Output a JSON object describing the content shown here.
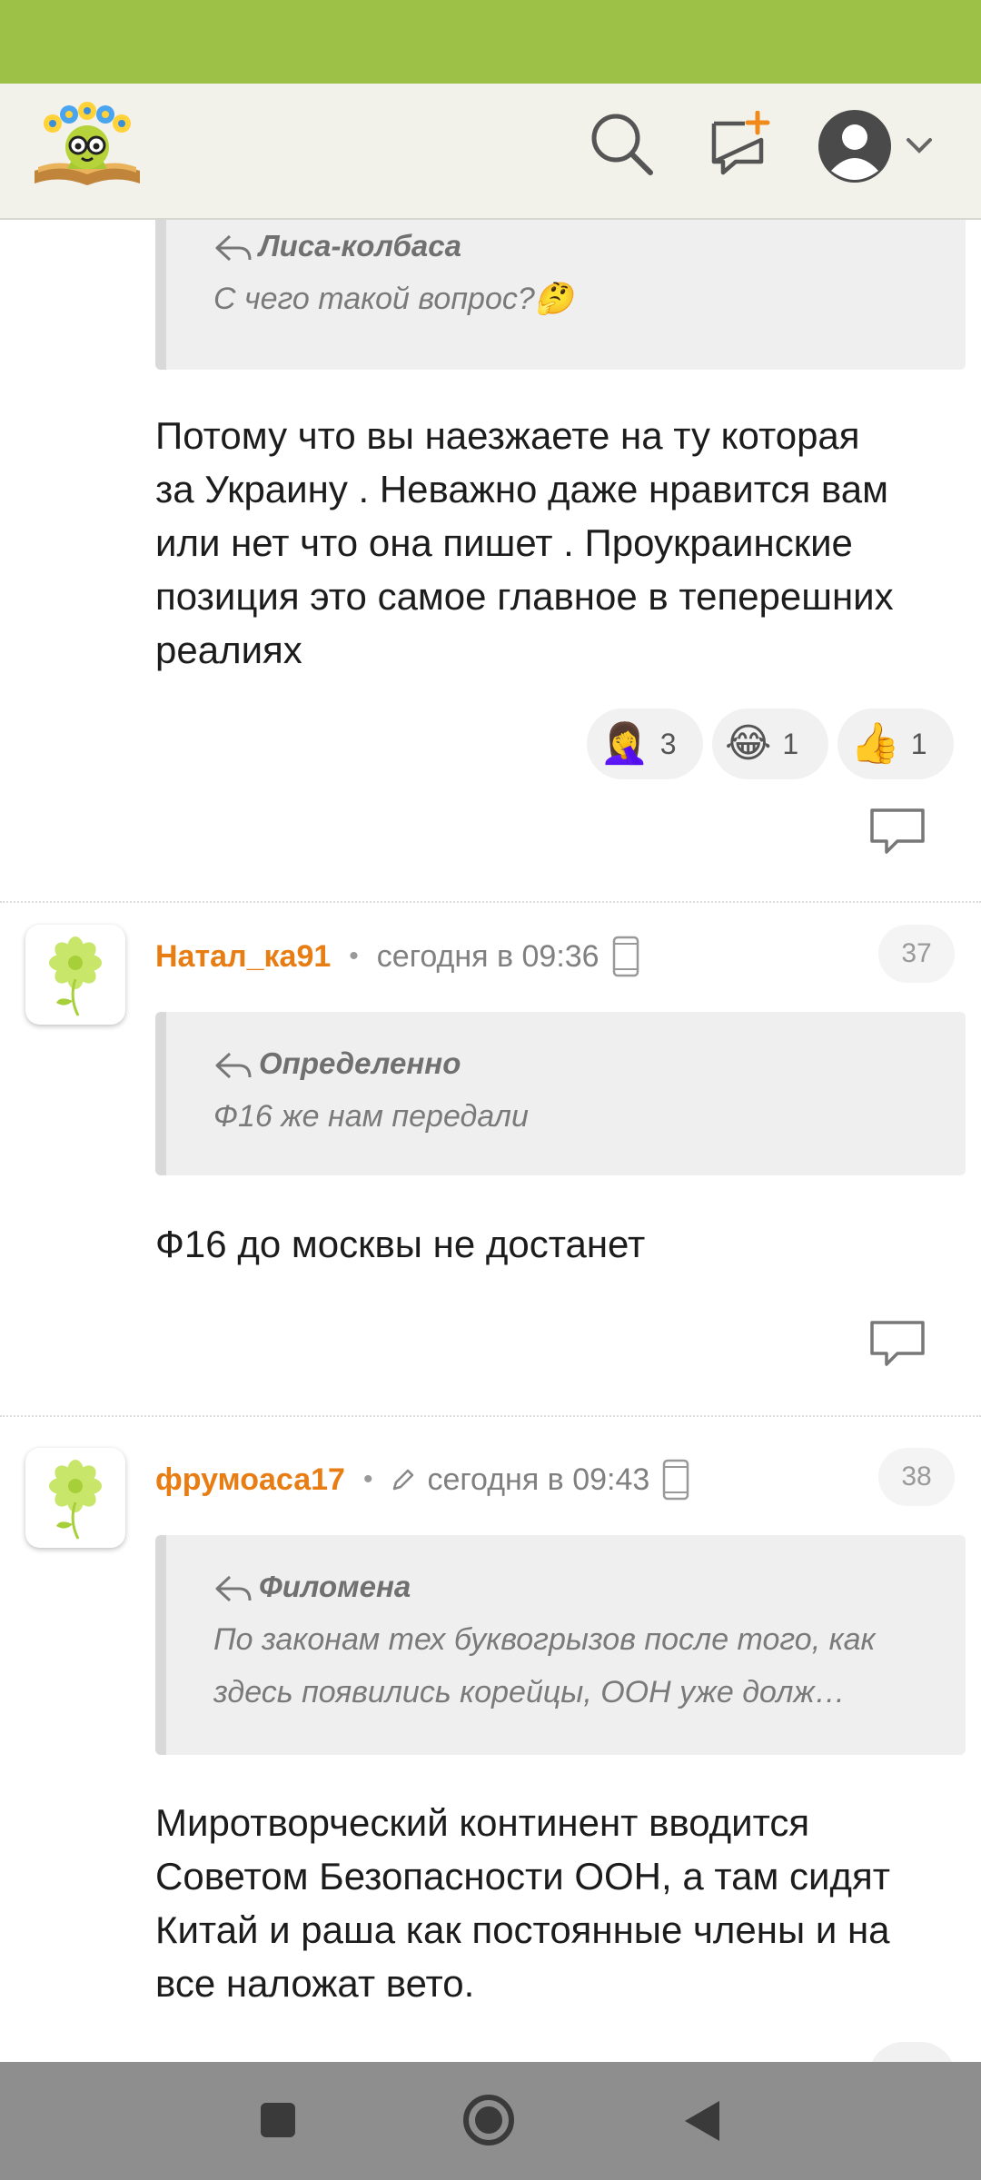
{
  "colors": {
    "status_bar": "#9dc146",
    "header_bg": "#f2f2ea",
    "author": "#e77d13",
    "quote_bg": "#efefef",
    "nav_bar": "#8e8e8e"
  },
  "header": {
    "icons": [
      "logo-icon",
      "search-icon",
      "new-message-icon",
      "profile-avatar-icon",
      "chevron-down-icon"
    ]
  },
  "feed": {
    "top_comment": {
      "quote": {
        "author": "Лиса-колбаса",
        "text": "С чего такой вопрос?🤔"
      },
      "text_lines": [
        "Потому что вы наезжаете на ту которая",
        "за Украину . Неважно даже нравится вам",
        "или нет что она пишет . Проукраинские",
        "позиция это самое главное в теперешних",
        "реалиях"
      ],
      "reactions": [
        {
          "emoji": "🤦‍♀️",
          "count": "3"
        },
        {
          "emoji": "😂",
          "count": "1"
        },
        {
          "emoji": "👍",
          "count": "1"
        }
      ]
    },
    "comment_37": {
      "author": "Натал_ка91",
      "time": "сегодня в 09:36",
      "number": "37",
      "quote": {
        "author": "Определенно",
        "text": "Ф16 же нам передали"
      },
      "text": "Ф16 до москвы не достанет"
    },
    "comment_38": {
      "author": "фрумоаса17",
      "time": "сегодня в 09:43",
      "number": "38",
      "quote": {
        "author": "Филомена",
        "text_lines": [
          "По законам тех буквогрызов после того, как",
          "здесь появились корейцы, ООН уже долж…"
        ]
      },
      "text_lines": [
        "Миротворческий континент вводится",
        "Советом Безопасности ООН, а там сидят",
        "Китай и раша как постоянные члены и на",
        "все наложат вето."
      ]
    }
  },
  "nav": {
    "icons": [
      "recent-apps-icon",
      "home-icon",
      "back-icon"
    ]
  }
}
